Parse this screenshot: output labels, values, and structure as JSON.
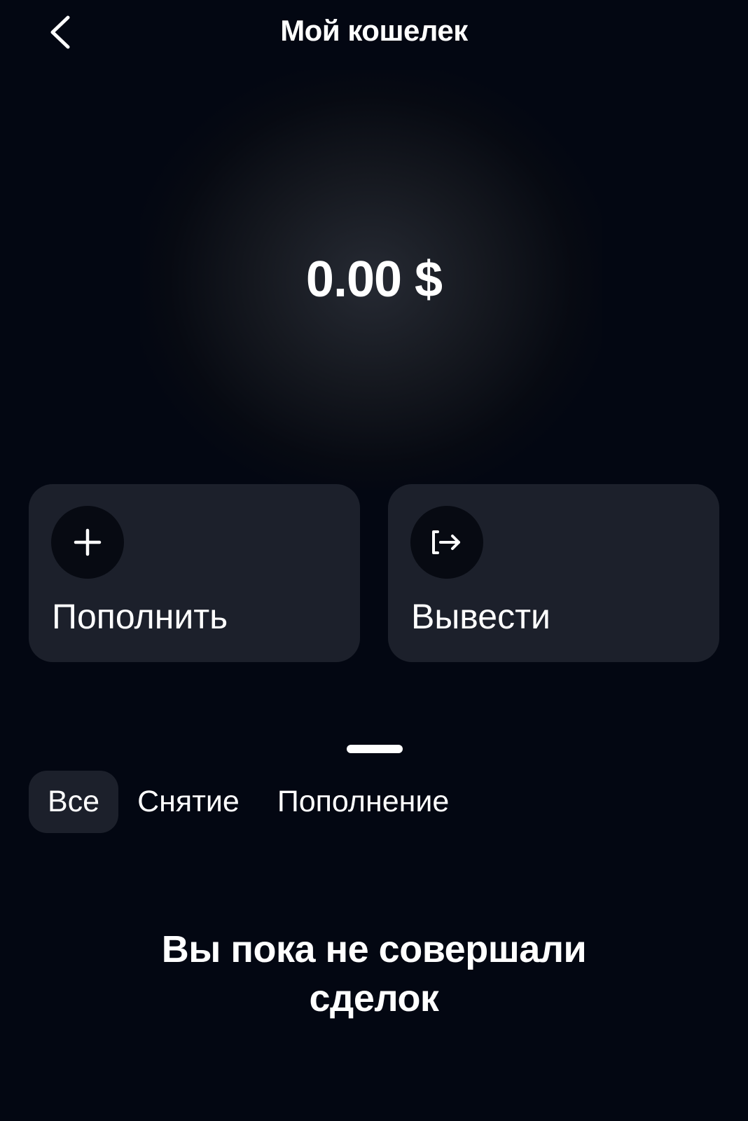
{
  "header": {
    "title": "Мой кошелек",
    "back_icon": "chevron-left-icon"
  },
  "wallet": {
    "balance": "0.00 $"
  },
  "actions": [
    {
      "label": "Пополнить",
      "icon": "plus-icon"
    },
    {
      "label": "Вывести",
      "icon": "exit-arrow-icon"
    }
  ],
  "tabs": {
    "items": [
      {
        "label": "Все",
        "active": true
      },
      {
        "label": "Снятие",
        "active": false
      },
      {
        "label": "Пополнение",
        "active": false
      }
    ]
  },
  "empty_state": {
    "line1": "Вы пока не совершали",
    "line2": "сделок"
  },
  "colors": {
    "background": "#030712",
    "card": "#1c202b",
    "icon_circle": "#070a12",
    "text": "#ffffff"
  }
}
